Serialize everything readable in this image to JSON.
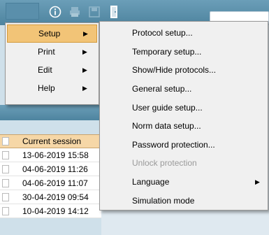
{
  "toolbar": {
    "icons": [
      "info-icon",
      "print-icon",
      "save-icon",
      "exit-door-icon"
    ]
  },
  "main_menu": {
    "items": [
      {
        "label": "Setup",
        "has_submenu": true,
        "active": true
      },
      {
        "label": "Print",
        "has_submenu": true,
        "active": false
      },
      {
        "label": "Edit",
        "has_submenu": true,
        "active": false
      },
      {
        "label": "Help",
        "has_submenu": true,
        "active": false
      }
    ]
  },
  "setup_submenu": {
    "items": [
      {
        "label": "Protocol setup...",
        "enabled": true,
        "has_submenu": false
      },
      {
        "label": "Temporary setup...",
        "enabled": true,
        "has_submenu": false
      },
      {
        "label": "Show/Hide protocols...",
        "enabled": true,
        "has_submenu": false
      },
      {
        "label": "General setup...",
        "enabled": true,
        "has_submenu": false
      },
      {
        "label": "User guide setup...",
        "enabled": true,
        "has_submenu": false
      },
      {
        "label": "Norm data setup...",
        "enabled": true,
        "has_submenu": false
      },
      {
        "label": "Password protection...",
        "enabled": true,
        "has_submenu": false
      },
      {
        "label": "Unlock protection",
        "enabled": false,
        "has_submenu": false
      },
      {
        "label": "Language",
        "enabled": true,
        "has_submenu": true
      },
      {
        "label": "Simulation mode",
        "enabled": true,
        "has_submenu": false
      }
    ]
  },
  "sessions": {
    "header": "Current session",
    "rows": [
      "13-06-2019 15:58",
      "04-06-2019 11:26",
      "04-06-2019 11:07",
      "30-04-2019 09:54",
      "10-04-2019 14:12"
    ]
  },
  "colors": {
    "toolbar": "#5a8fab",
    "menu_bg": "#f0f0f0",
    "menu_highlight": "#f2c477",
    "session_header": "#f6d7a7",
    "disabled_text": "#9a9a9a"
  }
}
